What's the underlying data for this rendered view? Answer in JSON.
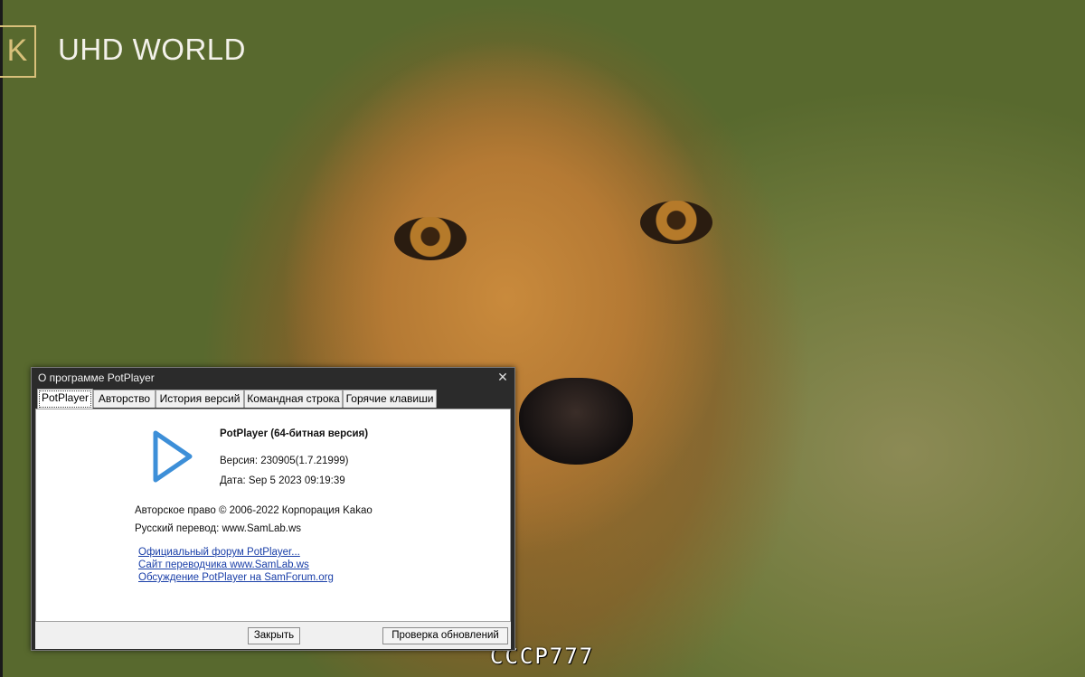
{
  "video": {
    "channel_logo_text": "UHD WORLD",
    "logo_mark": "K",
    "watermark": "СССР777"
  },
  "dialog": {
    "title": "О программе PotPlayer",
    "close_glyph": "✕",
    "tabs": [
      {
        "label": "PotPlayer",
        "active": true
      },
      {
        "label": "Авторство",
        "active": false
      },
      {
        "label": "История версий",
        "active": false
      },
      {
        "label": "Командная строка",
        "active": false
      },
      {
        "label": "Горячие клавиши",
        "active": false
      }
    ],
    "app_icon": "play-icon",
    "accent_color": "#3d8fd8",
    "product_name": "PotPlayer (64-битная версия)",
    "version": "Версия: 230905(1.7.21999)",
    "date": "Дата: Sep  5 2023 09:19:39",
    "copyright": "Авторское право © 2006-2022 Корпорация Kakao",
    "translation": "Русский перевод: www.SamLab.ws",
    "links": [
      "Официальный форум PotPlayer...",
      "Сайт переводчика www.SamLab.ws",
      "Обсуждение PotPlayer на SamForum.org"
    ],
    "buttons": {
      "close": "Закрыть",
      "check_updates": "Проверка обновлений"
    }
  }
}
